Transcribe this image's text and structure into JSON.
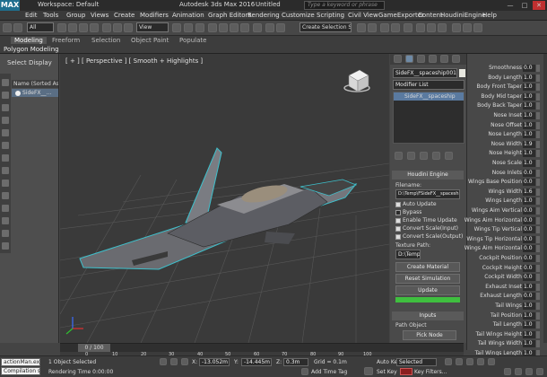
{
  "titlebar": {
    "logo": "MAX",
    "workspace": "Workspace: Default",
    "app_title": "Autodesk 3ds Max 2016",
    "doc_title": "Untitled",
    "search_placeholder": "Type a keyword or phrase",
    "minimize": "—",
    "maximize": "□",
    "close": "✕"
  },
  "menubar": [
    "Edit",
    "Tools",
    "Group",
    "Views",
    "Create",
    "Modifiers",
    "Animation",
    "Graph Editors",
    "Rendering",
    "Customize",
    "Scripting",
    "Civil View",
    "GameExporter",
    "Content",
    "HoudiniEngine",
    "Help"
  ],
  "toolbar": {
    "selection_filter": "All",
    "ref_coord": "View",
    "named_selection": "Create Selection Se"
  },
  "ribbon": {
    "tabs": [
      "Modeling",
      "Freeform",
      "Selection",
      "Object Paint",
      "Populate"
    ],
    "subtitle": "Polygon Modeling"
  },
  "scene_explorer": {
    "tabs": [
      "Select",
      "Display"
    ],
    "header": "Name (Sorted Ascend",
    "items": [
      "SideFX__..."
    ]
  },
  "viewport": {
    "label": "[ + ] [ Perspective ] [ Smooth + Highlights ]"
  },
  "modify_panel": {
    "object_name": "SideFX__spaceship001",
    "modifier_list": "Modifier List",
    "stack_item": "SideFX__spaceship",
    "rollout_title": "Houdini Engine",
    "filename_label": "Filename:",
    "filename_value": "D:\\Temp\\FSideFX__spaceship",
    "checkboxes": [
      "Auto Update",
      "Bypass",
      "Enable Time Update",
      "Convert Scale(Input)",
      "Convert Scale(Output)"
    ],
    "texture_label": "Texture Path:",
    "texture_value": "D:\\Temp\\F",
    "buttons": [
      "Create Material",
      "Reset Simulation",
      "Update"
    ],
    "inputs_title": "Inputs",
    "path_object_label": "Path Object",
    "pick_node": "Pick Node"
  },
  "parameters": [
    {
      "label": "Smoothness",
      "value": "0.0"
    },
    {
      "label": "Body Length",
      "value": "1.0"
    },
    {
      "label": "Body Front Taper",
      "value": "1.0"
    },
    {
      "label": "Body Mid taper",
      "value": "1.0"
    },
    {
      "label": "Body Back Taper",
      "value": "1.0"
    },
    {
      "label": "Nose Inset",
      "value": "1.0"
    },
    {
      "label": "Nose Offset",
      "value": "1.0"
    },
    {
      "label": "Nose Length",
      "value": "1.0"
    },
    {
      "label": "Nose Width",
      "value": "1.9"
    },
    {
      "label": "Nose Height",
      "value": "1.0"
    },
    {
      "label": "Nose Scale",
      "value": "1.0"
    },
    {
      "label": "Nose Inlets",
      "value": "0.0"
    },
    {
      "label": "Wings Base Position",
      "value": "0.0"
    },
    {
      "label": "Wings Width",
      "value": "1.6"
    },
    {
      "label": "Wings Length",
      "value": "1.0"
    },
    {
      "label": "Wings Aim Vertical",
      "value": "0.0"
    },
    {
      "label": "Wings Aim Horizontal",
      "value": "0.0"
    },
    {
      "label": "Wings Tip Vertical",
      "value": "0.0"
    },
    {
      "label": "Wings Tip Horizontal",
      "value": "0.0"
    },
    {
      "label": "Wings Aim Horizontal",
      "value": "0.0"
    },
    {
      "label": "Cockpit Position",
      "value": "0.0"
    },
    {
      "label": "Cockpit Height",
      "value": "0.0"
    },
    {
      "label": "Cockpit Width",
      "value": "0.0"
    },
    {
      "label": "Exhaust Inset",
      "value": "1.0"
    },
    {
      "label": "Exhaust Length",
      "value": "0.0"
    },
    {
      "label": "Tail Wings",
      "value": "1.0"
    },
    {
      "label": "Tail Position",
      "value": "1.0"
    },
    {
      "label": "Tail Length",
      "value": "1.0"
    },
    {
      "label": "Tail Wings Height",
      "value": "1.0"
    },
    {
      "label": "Tail Wings Width",
      "value": "1.0"
    },
    {
      "label": "Tail Wings Length",
      "value": "1.0"
    }
  ],
  "timeline": {
    "frame_readout": "0 / 100",
    "ticks": [
      "0",
      "10",
      "20",
      "30",
      "40",
      "50",
      "60",
      "70",
      "80",
      "90",
      "100"
    ]
  },
  "status": {
    "listener_top": "actionMan.execut",
    "listener_bottom": "Compilation succ",
    "selection": "1 Object Selected",
    "rendering_time": "Rendering Time 0:00:00",
    "x_label": "X:",
    "x_value": "-13.052m",
    "y_label": "Y:",
    "y_value": "-14.445m",
    "z_label": "Z:",
    "z_value": "0.3m",
    "grid": "Grid = 0.1m",
    "add_time_tag": "Add Time Tag",
    "auto_key": "Auto Key",
    "set_key": "Set Key",
    "key_mode": "Selected",
    "key_filters": "Key Filters..."
  },
  "colors": {
    "update_button": "#3fbf3f",
    "auto_key": "#8a1f1f"
  }
}
